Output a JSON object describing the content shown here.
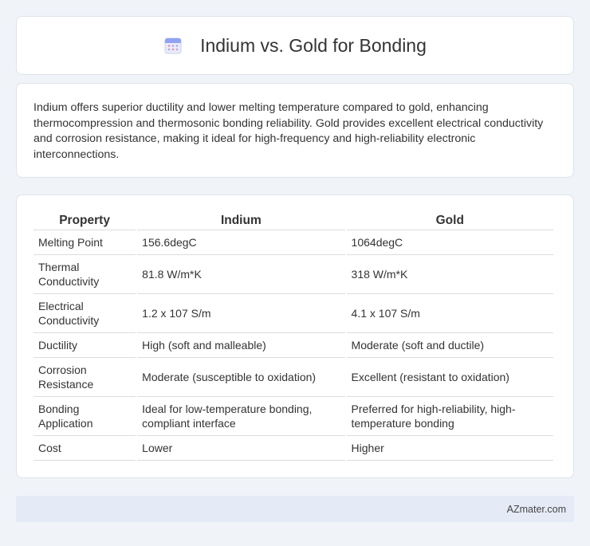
{
  "header": {
    "title": "Indium vs. Gold for Bonding",
    "icon": "calendar-icon"
  },
  "intro": {
    "text": "Indium offers superior ductility and lower melting temperature compared to gold, enhancing thermocompression and thermosonic bonding reliability. Gold provides excellent electrical conductivity and corrosion resistance, making it ideal for high-frequency and high-reliability electronic interconnections."
  },
  "table": {
    "headers": [
      "Property",
      "Indium",
      "Gold"
    ],
    "rows": [
      [
        "Melting Point",
        "156.6degC",
        "1064degC"
      ],
      [
        "Thermal Conductivity",
        "81.8 W/m*K",
        "318 W/m*K"
      ],
      [
        "Electrical Conductivity",
        "1.2 x 107 S/m",
        "4.1 x 107 S/m"
      ],
      [
        "Ductility",
        "High (soft and malleable)",
        "Moderate (soft and ductile)"
      ],
      [
        "Corrosion Resistance",
        "Moderate (susceptible to oxidation)",
        "Excellent (resistant to oxidation)"
      ],
      [
        "Bonding Application",
        "Ideal for low-temperature bonding, compliant interface",
        "Preferred for high-reliability, high-temperature bonding"
      ],
      [
        "Cost",
        "Lower",
        "Higher"
      ]
    ]
  },
  "footer": {
    "text": "AZmater.com"
  },
  "colors": {
    "background": "#f0f3f8",
    "card": "#ffffff",
    "footer": "#e5ebf6",
    "icon_accent": "#6f8ef0"
  }
}
